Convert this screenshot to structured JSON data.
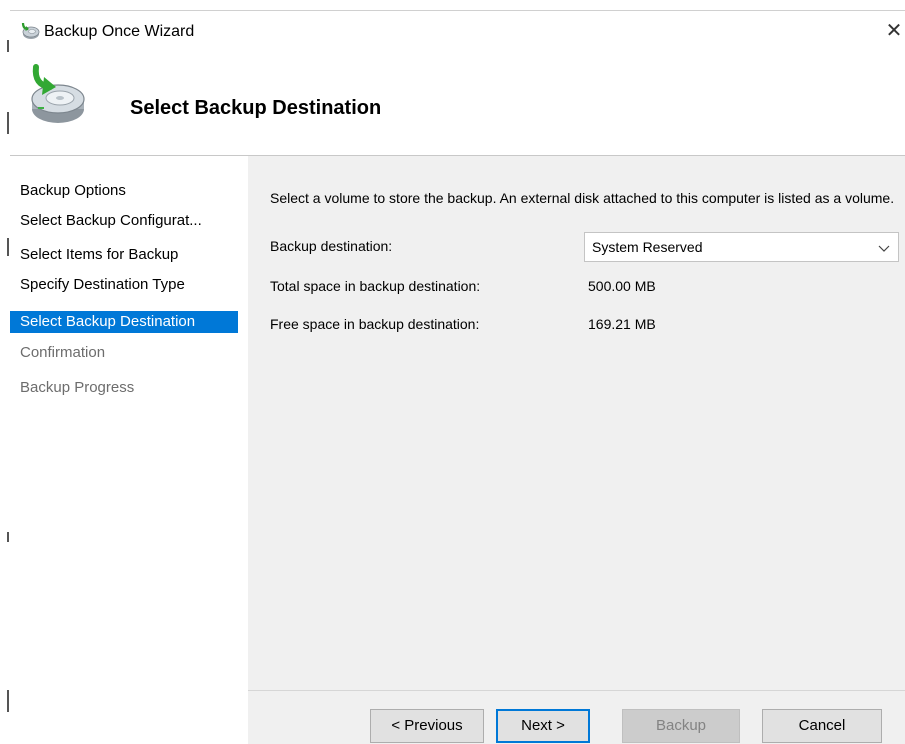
{
  "window": {
    "title": "Backup Once Wizard",
    "close_glyph": "✕"
  },
  "header": {
    "title": "Select Backup Destination",
    "icon": "backup-disk-icon"
  },
  "sidebar": {
    "items": [
      {
        "label": "Backup Options",
        "state": "normal"
      },
      {
        "label": "Select Backup Configurat...",
        "state": "normal"
      },
      {
        "label": "Select Items for Backup",
        "state": "normal"
      },
      {
        "label": "Specify Destination Type",
        "state": "normal"
      },
      {
        "label": "Select Backup Destination",
        "state": "active"
      },
      {
        "label": "Confirmation",
        "state": "disabled"
      },
      {
        "label": "Backup Progress",
        "state": "disabled"
      }
    ]
  },
  "main": {
    "instruction": "Select a volume to store the backup. An external disk attached to this computer is listed as a volume.",
    "destination_label": "Backup destination:",
    "destination_value": "System Reserved",
    "total_space_label": "Total space in backup destination:",
    "total_space_value": "500.00 MB",
    "free_space_label": "Free space in backup destination:",
    "free_space_value": "169.21 MB"
  },
  "buttons": {
    "previous": "< Previous",
    "next": "Next >",
    "backup": "Backup",
    "cancel": "Cancel"
  },
  "colors": {
    "accent": "#0078d7",
    "panel": "#f0f0f0",
    "disabled_text": "#6d6d6d"
  }
}
